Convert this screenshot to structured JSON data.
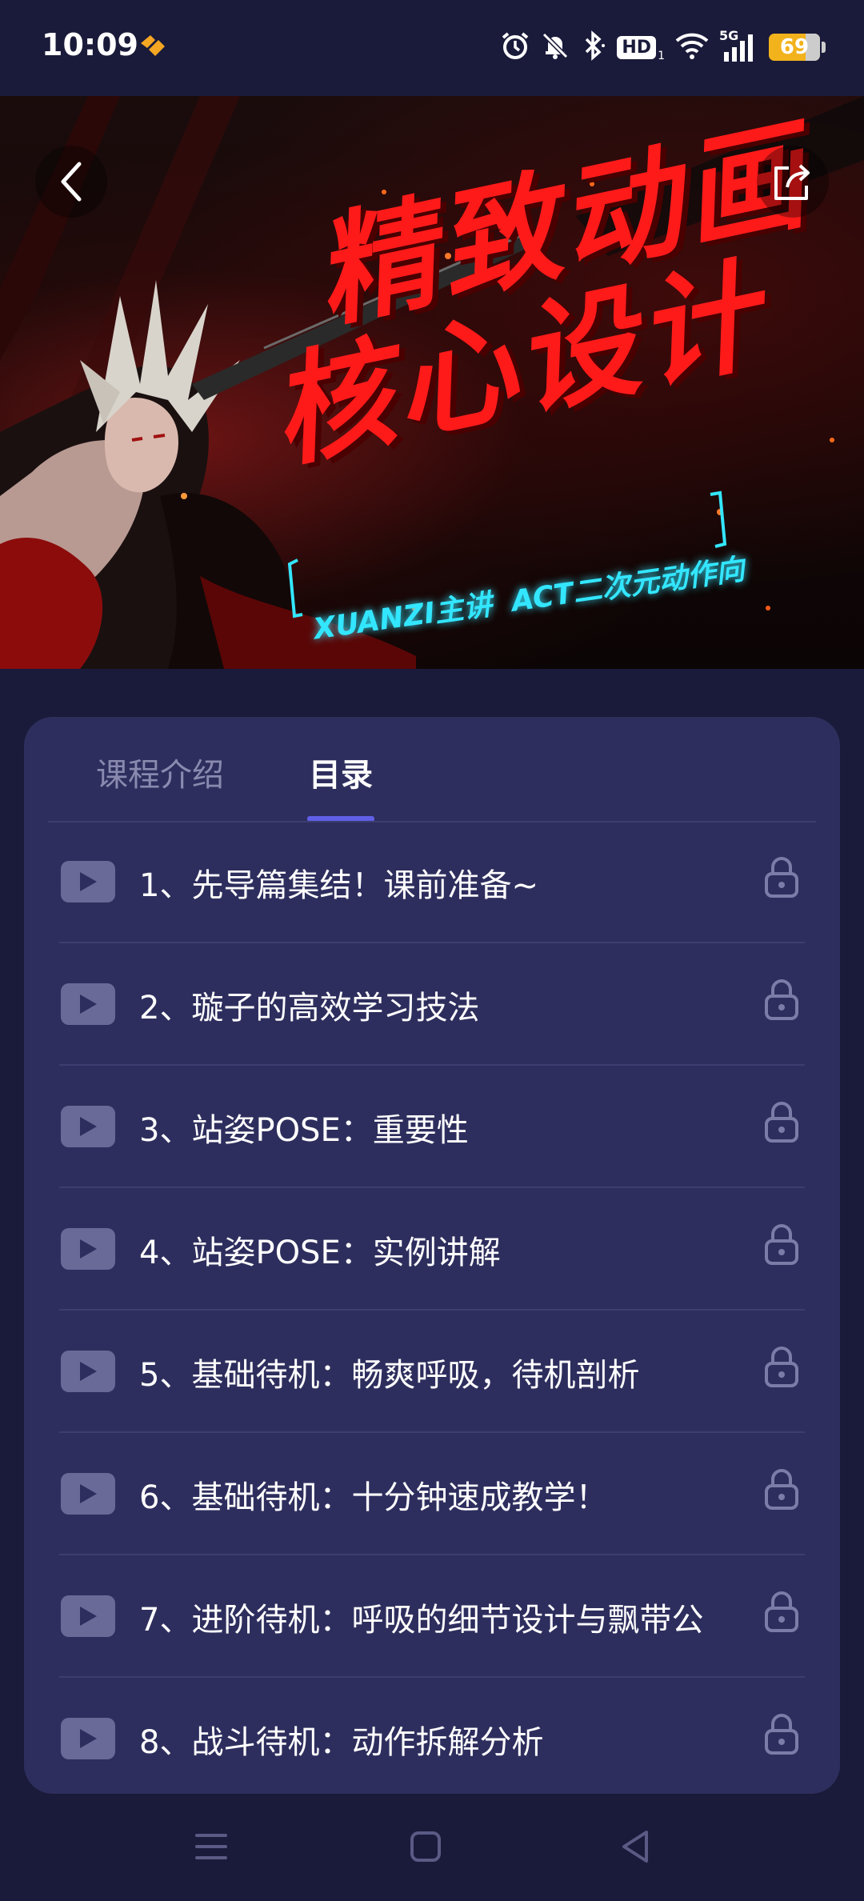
{
  "status_bar": {
    "time": "10:09",
    "hd_label": "HD",
    "hd_sub": "1",
    "network_label": "5G",
    "battery": "69",
    "icons": [
      "app-notification-icon",
      "alarm-icon",
      "mute-icon",
      "bluetooth-icon",
      "wifi-icon",
      "signal-icon",
      "battery-icon"
    ]
  },
  "banner": {
    "title_line1": "精致动画",
    "title_line2": "核心设计",
    "subtitle": "XUANZI主讲  ACT二次元动作向",
    "colors": {
      "title": "#ff1a1a",
      "subtitle": "#33e6ff"
    },
    "icons": {
      "back": "back-arrow-icon",
      "share": "share-icon"
    }
  },
  "tabs": [
    {
      "label": "课程介绍",
      "active": false
    },
    {
      "label": "目录",
      "active": true
    }
  ],
  "lessons": [
    {
      "title": "1、先导篇集结！课前准备~",
      "locked": true
    },
    {
      "title": "2、璇子的高效学习技法",
      "locked": true
    },
    {
      "title": "3、站姿POSE：重要性",
      "locked": true
    },
    {
      "title": "4、站姿POSE：实例讲解",
      "locked": true
    },
    {
      "title": "5、基础待机：畅爽呼吸，待机剖析",
      "locked": true
    },
    {
      "title": "6、基础待机：十分钟速成教学！",
      "locked": true
    },
    {
      "title": "7、进阶待机：呼吸的细节设计与飘带公",
      "locked": true
    },
    {
      "title": "8、战斗待机：动作拆解分析",
      "locked": true
    }
  ],
  "nav_bar": {
    "icons": [
      "menu-icon",
      "home-icon",
      "back-icon"
    ]
  },
  "theme": {
    "background": "#1a1a3a",
    "card": "#2e2e5e",
    "accent": "#5f5fe6"
  }
}
